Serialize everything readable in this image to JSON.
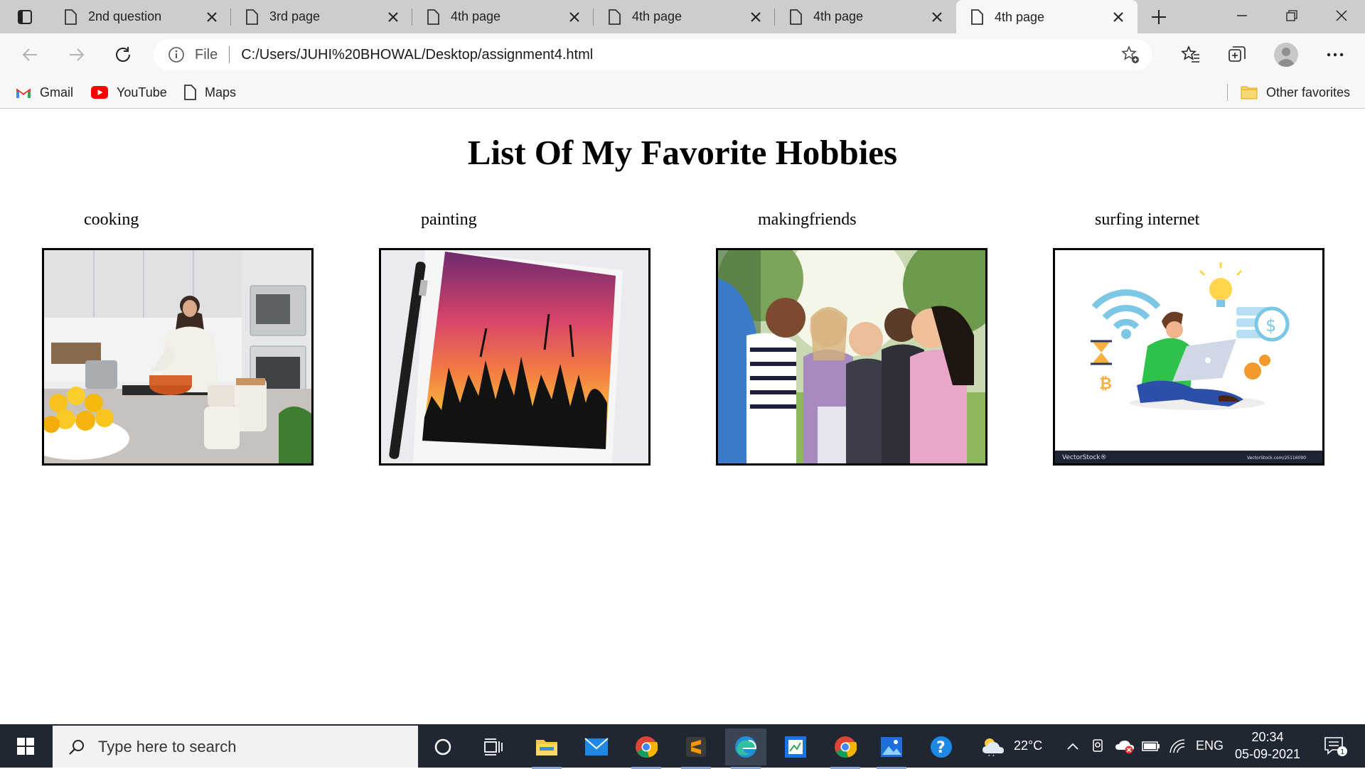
{
  "browser": {
    "tabs": [
      {
        "title": "2nd question",
        "active": false
      },
      {
        "title": "3rd page",
        "active": false
      },
      {
        "title": "4th page",
        "active": false
      },
      {
        "title": "4th page",
        "active": false
      },
      {
        "title": "4th page",
        "active": false
      },
      {
        "title": "4th page",
        "active": true
      }
    ],
    "address": {
      "scheme_label": "File",
      "url": "C:/Users/JUHI%20BHOWAL/Desktop/assignment4.html"
    },
    "favorites": [
      {
        "label": "Gmail",
        "icon": "gmail-icon"
      },
      {
        "label": "YouTube",
        "icon": "youtube-icon"
      },
      {
        "label": "Maps",
        "icon": "document-icon"
      }
    ],
    "other_favorites": "Other favorites"
  },
  "page": {
    "heading": "List Of My Favorite Hobbies",
    "hobbies": [
      {
        "label": "cooking",
        "image": "woman-cooking-in-kitchen-photo"
      },
      {
        "label": "painting",
        "image": "sunset-watercolor-painting-photo"
      },
      {
        "label": "makingfriends",
        "image": "group-of-friends-photo"
      },
      {
        "label": "surfing internet",
        "image": "person-with-laptop-illustration"
      }
    ],
    "watermark": {
      "brand": "VectorStock®",
      "id": "VectorStock.com/25116090"
    }
  },
  "taskbar": {
    "search_placeholder": "Type here to search",
    "weather": "22°C",
    "language": "ENG",
    "time": "20:34",
    "date": "05-09-2021",
    "notification_count": "1"
  },
  "colors": {
    "tabstrip": "#cdcdcd",
    "toolbar": "#f7f7f7",
    "taskbar": "#202733",
    "accent": "#0078d4"
  }
}
